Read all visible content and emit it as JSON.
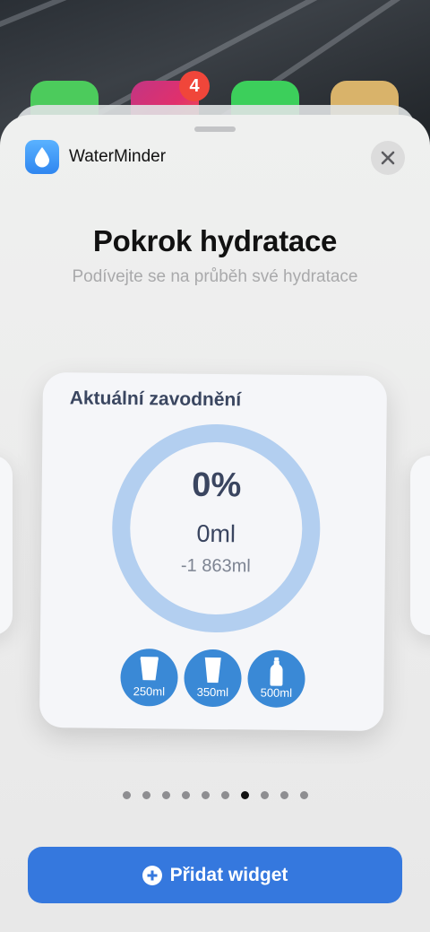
{
  "home_screen": {
    "badge_count": "4"
  },
  "sheet": {
    "app_name": "WaterMinder",
    "title": "Pokrok hydratace",
    "subtitle": "Podívejte se na průběh své hydratace"
  },
  "widget": {
    "title": "Aktuální zavodnění",
    "percent": "0%",
    "progress": 0,
    "amount": "0ml",
    "remaining": "-1 863ml",
    "cups": [
      {
        "label": "250ml",
        "icon": "cup-icon"
      },
      {
        "label": "350ml",
        "icon": "glass-icon"
      },
      {
        "label": "500ml",
        "icon": "bottle-icon"
      }
    ]
  },
  "pagination": {
    "total": 10,
    "active_index": 6
  },
  "actions": {
    "add_widget_label": "Přidat widget"
  },
  "colors": {
    "accent": "#3578de",
    "ring": "#b3cff0",
    "cup_button": "#3a89d6",
    "widget_text": "#3a4560"
  }
}
